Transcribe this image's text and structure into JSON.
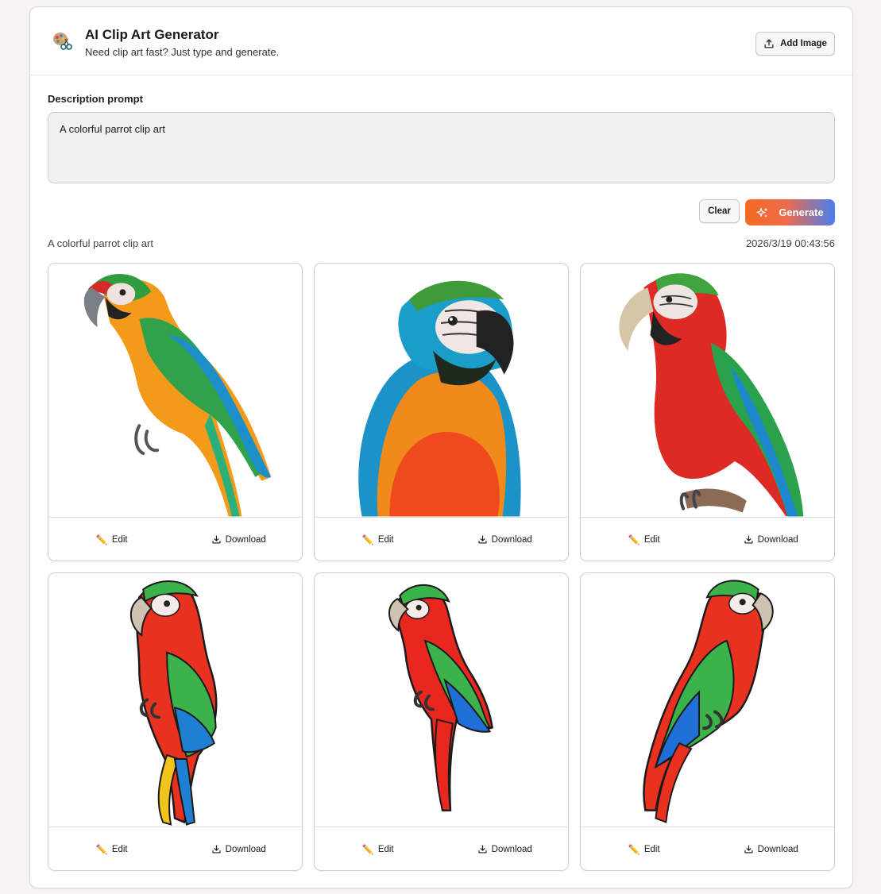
{
  "header": {
    "title": "AI Clip Art Generator",
    "subtitle": "Need clip art fast? Just type and generate.",
    "logo_icon": "palette-scissors-icon",
    "add_image_label": "Add Image"
  },
  "prompt": {
    "label": "Description prompt",
    "value": "A colorful parrot clip art"
  },
  "actions": {
    "clear_label": "Clear",
    "generate_label": "Generate"
  },
  "result": {
    "caption": "A colorful parrot clip art",
    "timestamp": "2026/3/19 00:43:56",
    "cards": [
      {
        "edit_label": "Edit",
        "download_label": "Download",
        "style": "photo-macaw-green-wing"
      },
      {
        "edit_label": "Edit",
        "download_label": "Download",
        "style": "photo-macaw-blue-gold"
      },
      {
        "edit_label": "Edit",
        "download_label": "Download",
        "style": "photo-macaw-red"
      },
      {
        "edit_label": "Edit",
        "download_label": "Download",
        "style": "cartoon-macaw-left"
      },
      {
        "edit_label": "Edit",
        "download_label": "Download",
        "style": "cartoon-macaw-left-small"
      },
      {
        "edit_label": "Edit",
        "download_label": "Download",
        "style": "cartoon-macaw-right"
      }
    ]
  },
  "colors": {
    "generate_gradient_start": "#f46a23",
    "generate_gradient_end": "#4a7ef0",
    "page_background": "#f6f4f0"
  }
}
